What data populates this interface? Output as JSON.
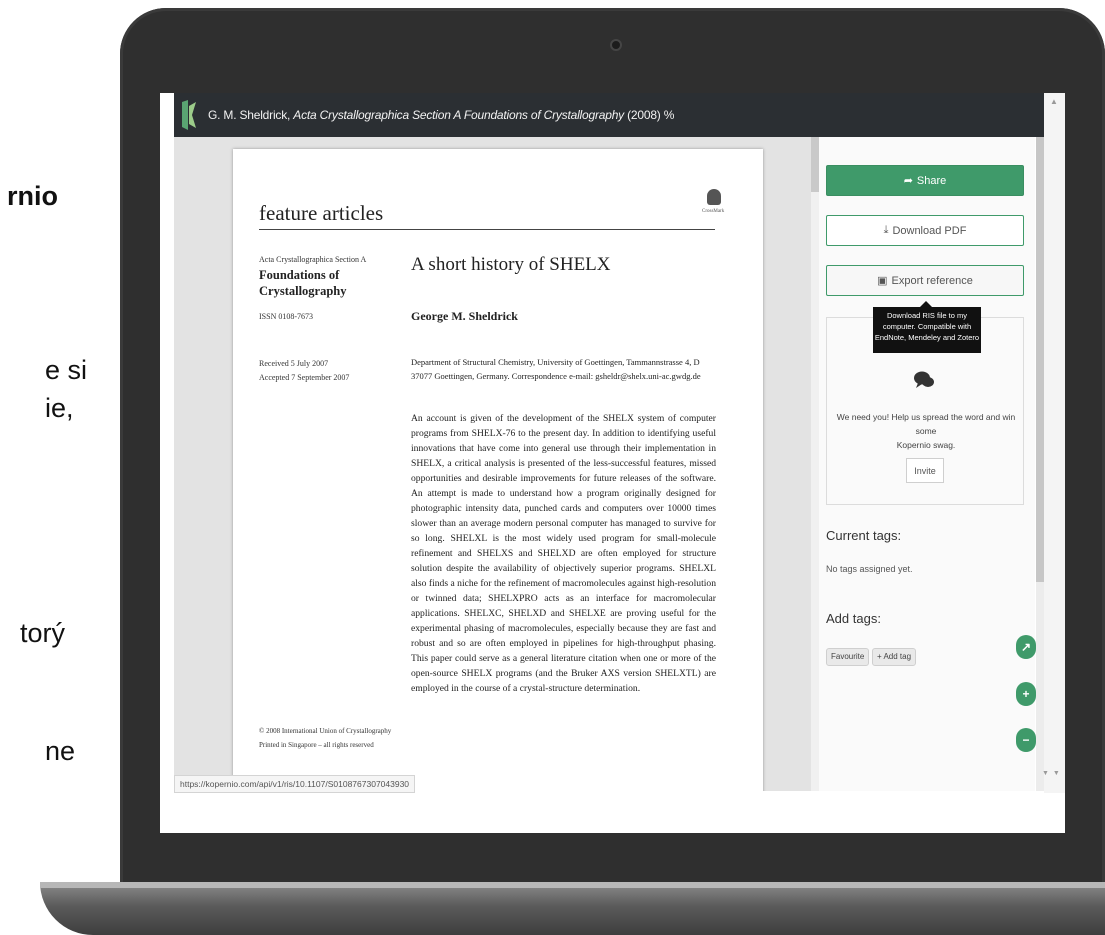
{
  "slide_fragments": [
    "rnio",
    "e si",
    "ie,",
    "torý",
    "ne"
  ],
  "app": {
    "title": {
      "author": "G. M. Sheldrick, ",
      "journal": "Acta Crystallographica Section A Foundations of Crystallography",
      "year": " (2008)",
      "link_glyph": " %"
    }
  },
  "document": {
    "section_heading": "feature articles",
    "seal_caption": "CrossMark",
    "journal_small": "Acta Crystallographica Section A",
    "journal_name": "Foundations of Crystallography",
    "issn": "ISSN 0108-7673",
    "received": "Received 5 July 2007",
    "accepted": "Accepted 7 September 2007",
    "article_title": "A short history of SHELX",
    "author": "George M. Sheldrick",
    "affiliation": "Department of Structural Chemistry, University of Goettingen, Tammannstrasse 4, D 37077 Goettingen, Germany. Correspondence e-mail: gsheldr@shelx.uni-ac.gwdg.de",
    "abstract": "An account is given of the development of the SHELX system of computer programs from SHELX-76 to the present day. In addition to identifying useful innovations that have come into general use through their implementation in SHELX, a critical analysis is presented of the less-successful features, missed opportunities and desirable improvements for future releases of the software. An attempt is made to understand how a program originally designed for photographic intensity data, punched cards and computers over 10000 times slower than an average modern personal computer has managed to survive for so long. SHELXL is the most widely used program for small-molecule refinement and SHELXS and SHELXD are often employed for structure solution despite the availability of objectively superior programs. SHELXL also finds a niche for the refinement of macromolecules against high-resolution or twinned data; SHELXPRO acts as an interface for macromolecular applications. SHELXC, SHELXD and SHELXE are proving useful for the experimental phasing of macromolecules, especially because they are fast and robust and so are often employed in pipelines for high-throughput phasing. This paper could serve as a general literature citation when one or more of the open-source SHELX programs (and the Bruker AXS version SHELXTL) are employed in the course of a crystal-structure determination.",
    "copyright": "© 2008 International Union of Crystallography",
    "printed": "Printed in Singapore – all rights reserved"
  },
  "status_url": "https://kopernio.com/api/v1/ris/10.1107/S0108767307043930",
  "sidebar": {
    "share_label": "Share",
    "download_label": "Download PDF",
    "export_label": "Export reference",
    "tooltip": "Download RIS file to my computer. Compatible with EndNote, Mendeley and Zotero",
    "invite_text": "We need you! Help us spread the word and win some",
    "invite_brand": "Kopernio swag.",
    "invite_button": "Invite",
    "current_tags_heading": "Current tags:",
    "no_tags": "No tags assigned yet.",
    "add_tags_heading": "Add tags:",
    "tags": [
      "Favourite",
      "+ Add tag"
    ],
    "fab_expand": "↗",
    "fab_zoom_in": "+",
    "fab_zoom_out": "−"
  },
  "colors": {
    "accent_green": "#3f9a6a",
    "topbar": "#2b2f33",
    "laptop_frame": "#2f2f2f"
  }
}
